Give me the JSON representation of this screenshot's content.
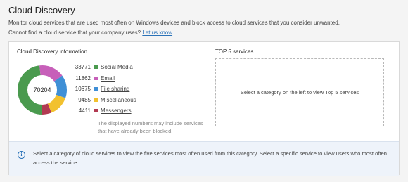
{
  "header": {
    "title": "Cloud Discovery",
    "description": "Monitor cloud services that are used most often on Windows devices and block access to cloud services that you consider unwanted.",
    "question": "Cannot find a cloud service that your company uses?",
    "link": "Let us know"
  },
  "discovery": {
    "title": "Cloud Discovery information",
    "total": "70204",
    "categories": [
      {
        "count": "33771",
        "label": "Social Media",
        "value": 33771,
        "color": "#4a9a4e"
      },
      {
        "count": "11862",
        "label": "Email",
        "value": 11862,
        "color": "#c75fb9"
      },
      {
        "count": "10675",
        "label": "File sharing",
        "value": 10675,
        "color": "#3f8fd6"
      },
      {
        "count": "9485",
        "label": "Miscellaneous",
        "value": 9485,
        "color": "#f2c12e"
      },
      {
        "count": "4411",
        "label": "Messengers",
        "value": 4411,
        "color": "#b23a52"
      }
    ],
    "note": "The displayed numbers may include services that have already been blocked."
  },
  "top5": {
    "title": "TOP 5 services",
    "placeholder": "Select a category on the left to view Top 5 services"
  },
  "info": {
    "icon": "info-icon",
    "text": "Select a category of cloud services to view the five services most often used from this category. Select a specific service to view users who most often access the service."
  }
}
